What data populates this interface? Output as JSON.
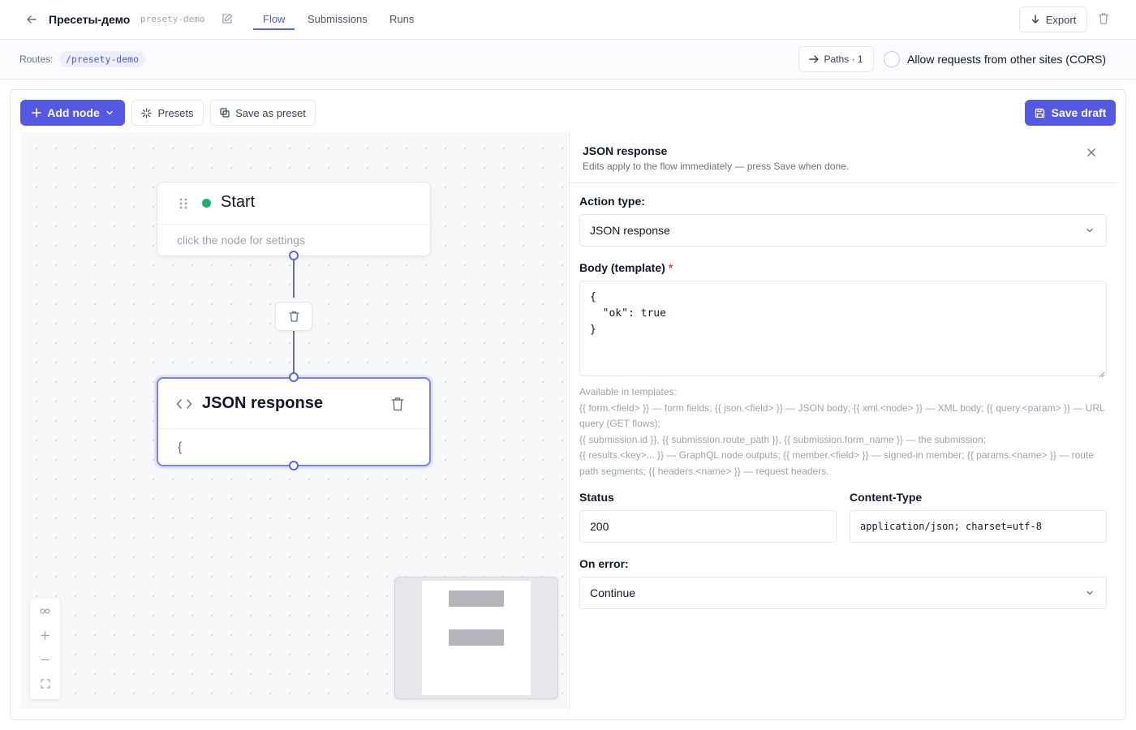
{
  "header": {
    "title": "Пресеты-демо",
    "slug": "presety-demo",
    "tabs": [
      {
        "label": "Flow",
        "active": true
      },
      {
        "label": "Submissions",
        "active": false
      },
      {
        "label": "Runs",
        "active": false
      }
    ],
    "export_label": "Export"
  },
  "routes": {
    "label": "Routes:",
    "route": "/presety-demo",
    "paths_label": "Paths · 1",
    "cors_label": "Allow requests from other sites (CORS)",
    "cors_checked": false
  },
  "toolbar": {
    "add_node_label": "Add node",
    "presets_label": "Presets",
    "save_as_preset_label": "Save as preset",
    "save_draft_label": "Save draft"
  },
  "canvas": {
    "start_node": {
      "title": "Start",
      "subtitle": "click the node for settings"
    },
    "json_node": {
      "title": "JSON response",
      "body": "{"
    }
  },
  "panel": {
    "title": "JSON response",
    "subtitle": "Edits apply to the flow immediately — press Save when done.",
    "action_type_label": "Action type:",
    "action_type_value": "JSON response",
    "body_label": "Body (template)",
    "body_required_mark": "*",
    "body_value": "{\n  \"ok\": true\n}",
    "help_text": "Available in templates:\n{{ form.<field> }} — form fields; {{ json.<field> }} — JSON body; {{ xml.<node> }} — XML body; {{ query.<param> }} — URL query (GET flows);\n{{ submission.id }}, {{ submission.route_path }}, {{ submission.form_name }} — the submission;\n{{ results.<key>... }} — GraphQL node outputs; {{ member.<field> }} — signed-in member; {{ params.<name> }} — route path segments; {{ headers.<name> }} — request headers.",
    "status_label": "Status",
    "status_value": "200",
    "content_type_label": "Content-Type",
    "content_type_value": "application/json; charset=utf-8",
    "on_error_label": "On error:",
    "on_error_value": "Continue"
  },
  "colors": {
    "accent": "#5558e3",
    "start_dot": "#16b46e",
    "required": "#ef4444"
  }
}
